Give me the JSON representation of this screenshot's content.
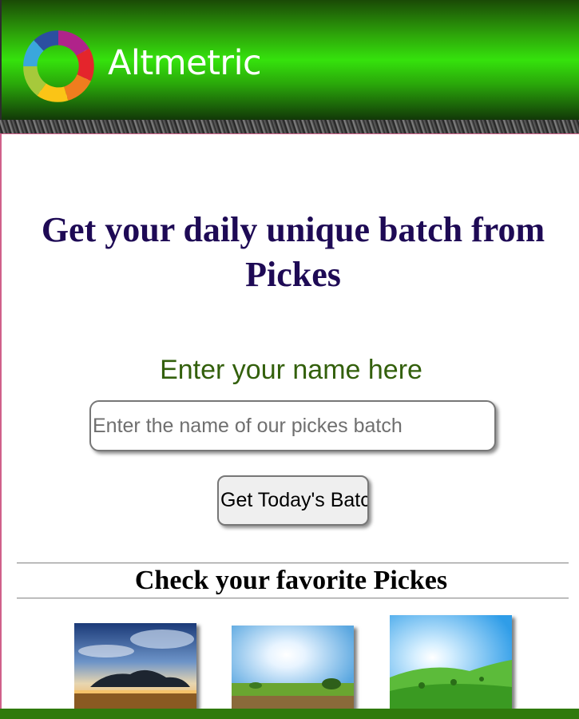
{
  "header": {
    "brand_name": "Altmetric",
    "logo_icon": "altmetric-donut-icon"
  },
  "main": {
    "headline": "Get your daily unique batch from Pickes",
    "name_label": "Enter your name here",
    "name_input": {
      "placeholder": "Enter the name of our pickes batch",
      "value": ""
    },
    "submit_button_label": "Get Today's Batch",
    "favorites_title": "Check your favorite Pickes"
  },
  "gallery": [
    {
      "name": "sunset-clouds-image"
    },
    {
      "name": "sunny-meadow-image"
    },
    {
      "name": "green-hills-image"
    }
  ],
  "colors": {
    "header_green": "#35e20c",
    "headline": "#1e0a55",
    "label_green": "#33600c",
    "content_border": "#d0608a"
  }
}
